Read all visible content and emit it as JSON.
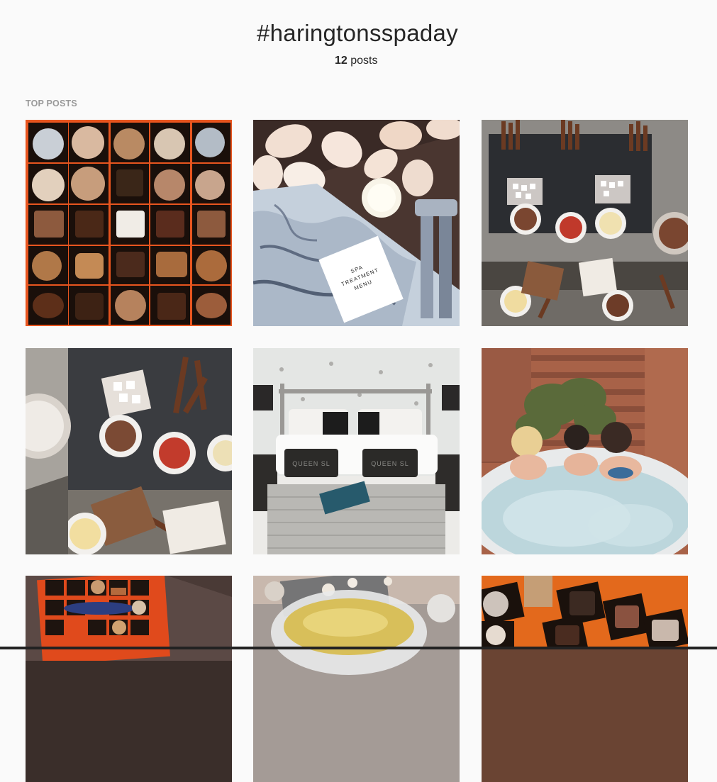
{
  "hashtag": {
    "title": "#haringtonsspaday",
    "count_number": "12",
    "count_label": " posts"
  },
  "top_posts": {
    "label": "TOP POSTS",
    "items": [
      {
        "subject": "chocolate-box"
      },
      {
        "subject": "spa-treatment-menu",
        "menu_lines": [
          "SPA",
          "TREATMENT",
          "MENU"
        ]
      },
      {
        "subject": "chocolate-dessert-bar"
      },
      {
        "subject": "chocolate-dessert-bar-closeup"
      },
      {
        "subject": "hotel-bedroom",
        "pillow_text": "QUEEN SL"
      },
      {
        "subject": "hot-tub-friends"
      },
      {
        "subject": "chocolate-box-orange"
      },
      {
        "subject": "dessert-bowl"
      },
      {
        "subject": "chocolate-box-orange-closeup"
      }
    ]
  },
  "colors": {
    "background": "#fafafa",
    "text": "#262626",
    "label": "#999999"
  }
}
